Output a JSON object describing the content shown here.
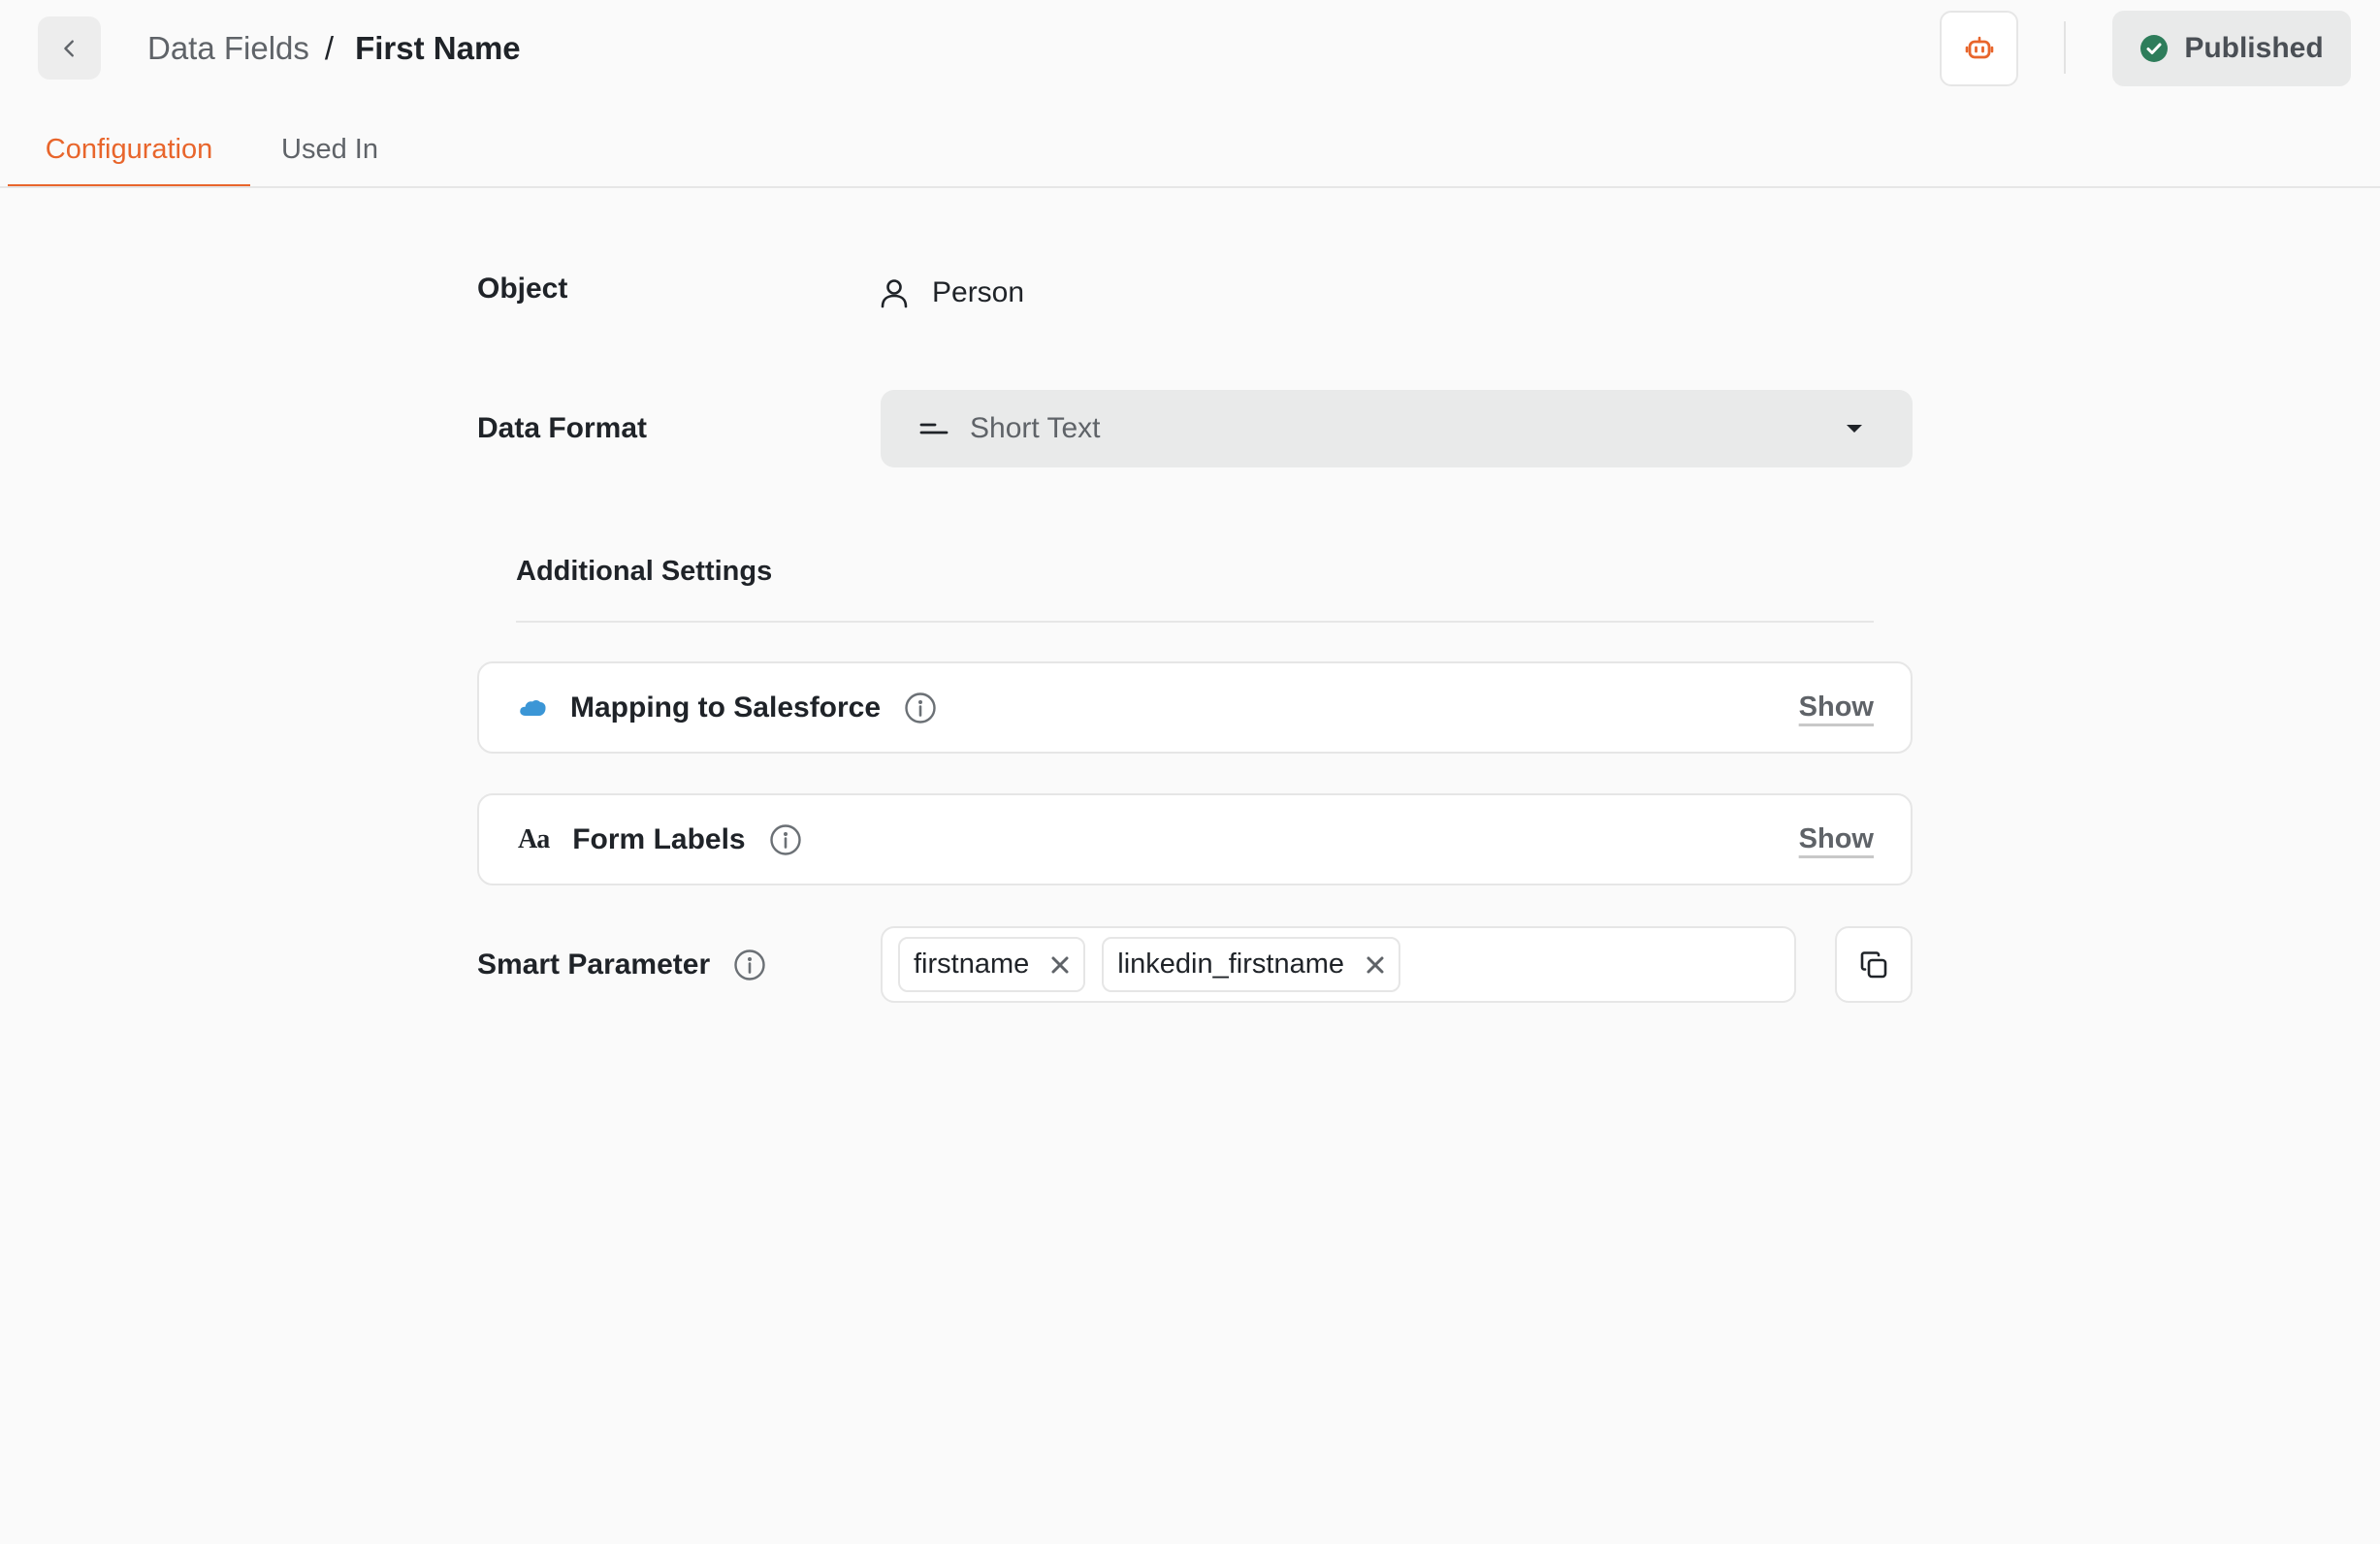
{
  "header": {
    "breadcrumb_parent": "Data Fields",
    "breadcrumb_separator": "/",
    "breadcrumb_current": "First Name",
    "status_label": "Published",
    "status_color": "#2e7d5b",
    "accent_color": "#e8652b"
  },
  "tabs": [
    {
      "label": "Configuration",
      "active": true
    },
    {
      "label": "Used In",
      "active": false
    }
  ],
  "form": {
    "object_label": "Object",
    "object_value": "Person",
    "data_format_label": "Data Format",
    "data_format_value": "Short Text",
    "additional_settings_title": "Additional Settings",
    "cards": [
      {
        "title": "Mapping to Salesforce",
        "action": "Show",
        "icon": "salesforce-cloud-icon"
      },
      {
        "title": "Form Labels",
        "action": "Show",
        "icon": "text-format-icon"
      }
    ],
    "smart_parameter_label": "Smart Parameter",
    "smart_parameter_tags": [
      "firstname",
      "linkedin_firstname"
    ]
  }
}
